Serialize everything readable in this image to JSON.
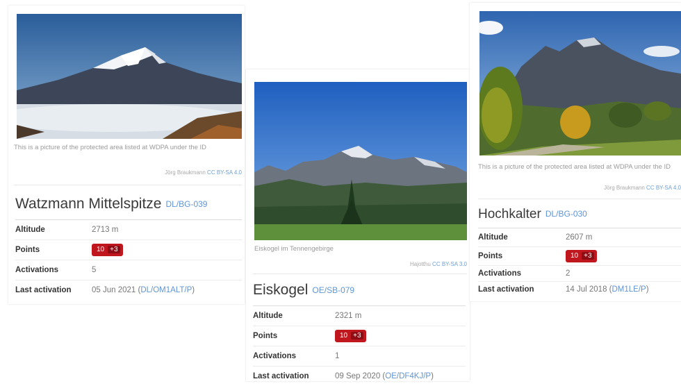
{
  "cards": [
    {
      "caption": "This is a picture of the protected area listed at WDPA under the ID",
      "credit": "Jörg Braukmann",
      "credit_license": "CC BY-SA 4.0",
      "title": "Watzmann Mittelspitze",
      "reference": "DL/BG-039",
      "rows": {
        "altitude_label": "Altitude",
        "altitude_value": "2713 m",
        "points_label": "Points",
        "points_value": "10",
        "points_bonus": "+3",
        "activations_label": "Activations",
        "activations_value": "5",
        "last_label": "Last activation",
        "last_date": "05 Jun 2021",
        "last_call": "DL/OM1ALT/P"
      }
    },
    {
      "caption": "Eiskogel im Tennengebirge",
      "credit": "Hajotthu",
      "credit_license": "CC BY-SA 3.0",
      "title": "Eiskogel",
      "reference": "OE/SB-079",
      "rows": {
        "altitude_label": "Altitude",
        "altitude_value": "2321 m",
        "points_label": "Points",
        "points_value": "10",
        "points_bonus": "+3",
        "activations_label": "Activations",
        "activations_value": "1",
        "last_label": "Last activation",
        "last_date": "09 Sep 2020",
        "last_call": "OE/DF4KJ/P"
      }
    },
    {
      "caption": "This is a picture of the protected area listed at WDPA under the ID",
      "credit": "Jörg Braukmann",
      "credit_license": "CC BY-SA 4.0",
      "title": "Hochkalter",
      "reference": "DL/BG-030",
      "rows": {
        "altitude_label": "Altitude",
        "altitude_value": "2607 m",
        "points_label": "Points",
        "points_value": "10",
        "points_bonus": "+3",
        "activations_label": "Activations",
        "activations_value": "2",
        "last_label": "Last activation",
        "last_date": "14 Jul 2018",
        "last_call": "DM1LE/P"
      }
    }
  ],
  "colors": {
    "points_badge": "#c0171f",
    "bonus_badge": "#8e0d14",
    "link": "#5f95d6"
  },
  "icons": [
    "mountain-photo"
  ]
}
